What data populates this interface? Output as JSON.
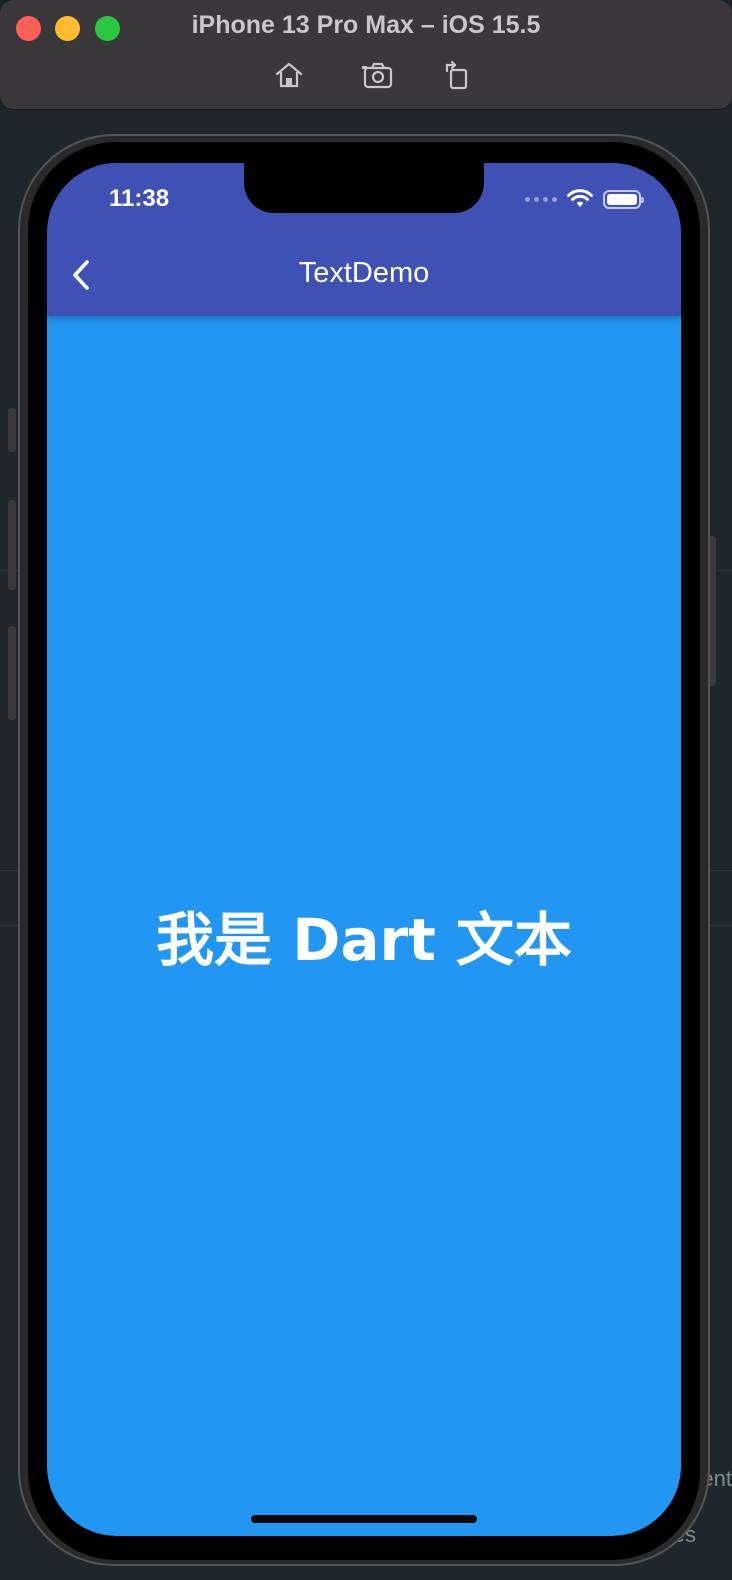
{
  "window": {
    "title": "iPhone 13 Pro Max – iOS 15.5",
    "toolbar": {
      "home_icon": "home-icon",
      "screenshot_icon": "camera-icon",
      "rotate_icon": "rotate-icon"
    }
  },
  "status_bar": {
    "time": "11:38",
    "icons": [
      "signal-dots-icon",
      "wifi-icon",
      "battery-icon"
    ]
  },
  "app_bar": {
    "title": "TextDemo",
    "back_icon": "chevron-left-icon",
    "color": "#3f51b5"
  },
  "body": {
    "text": "我是 Dart 文本",
    "background": "#2196f3",
    "text_color": "#ffffff"
  },
  "background_editor": {
    "fragments": [
      "ent",
      "es"
    ]
  }
}
